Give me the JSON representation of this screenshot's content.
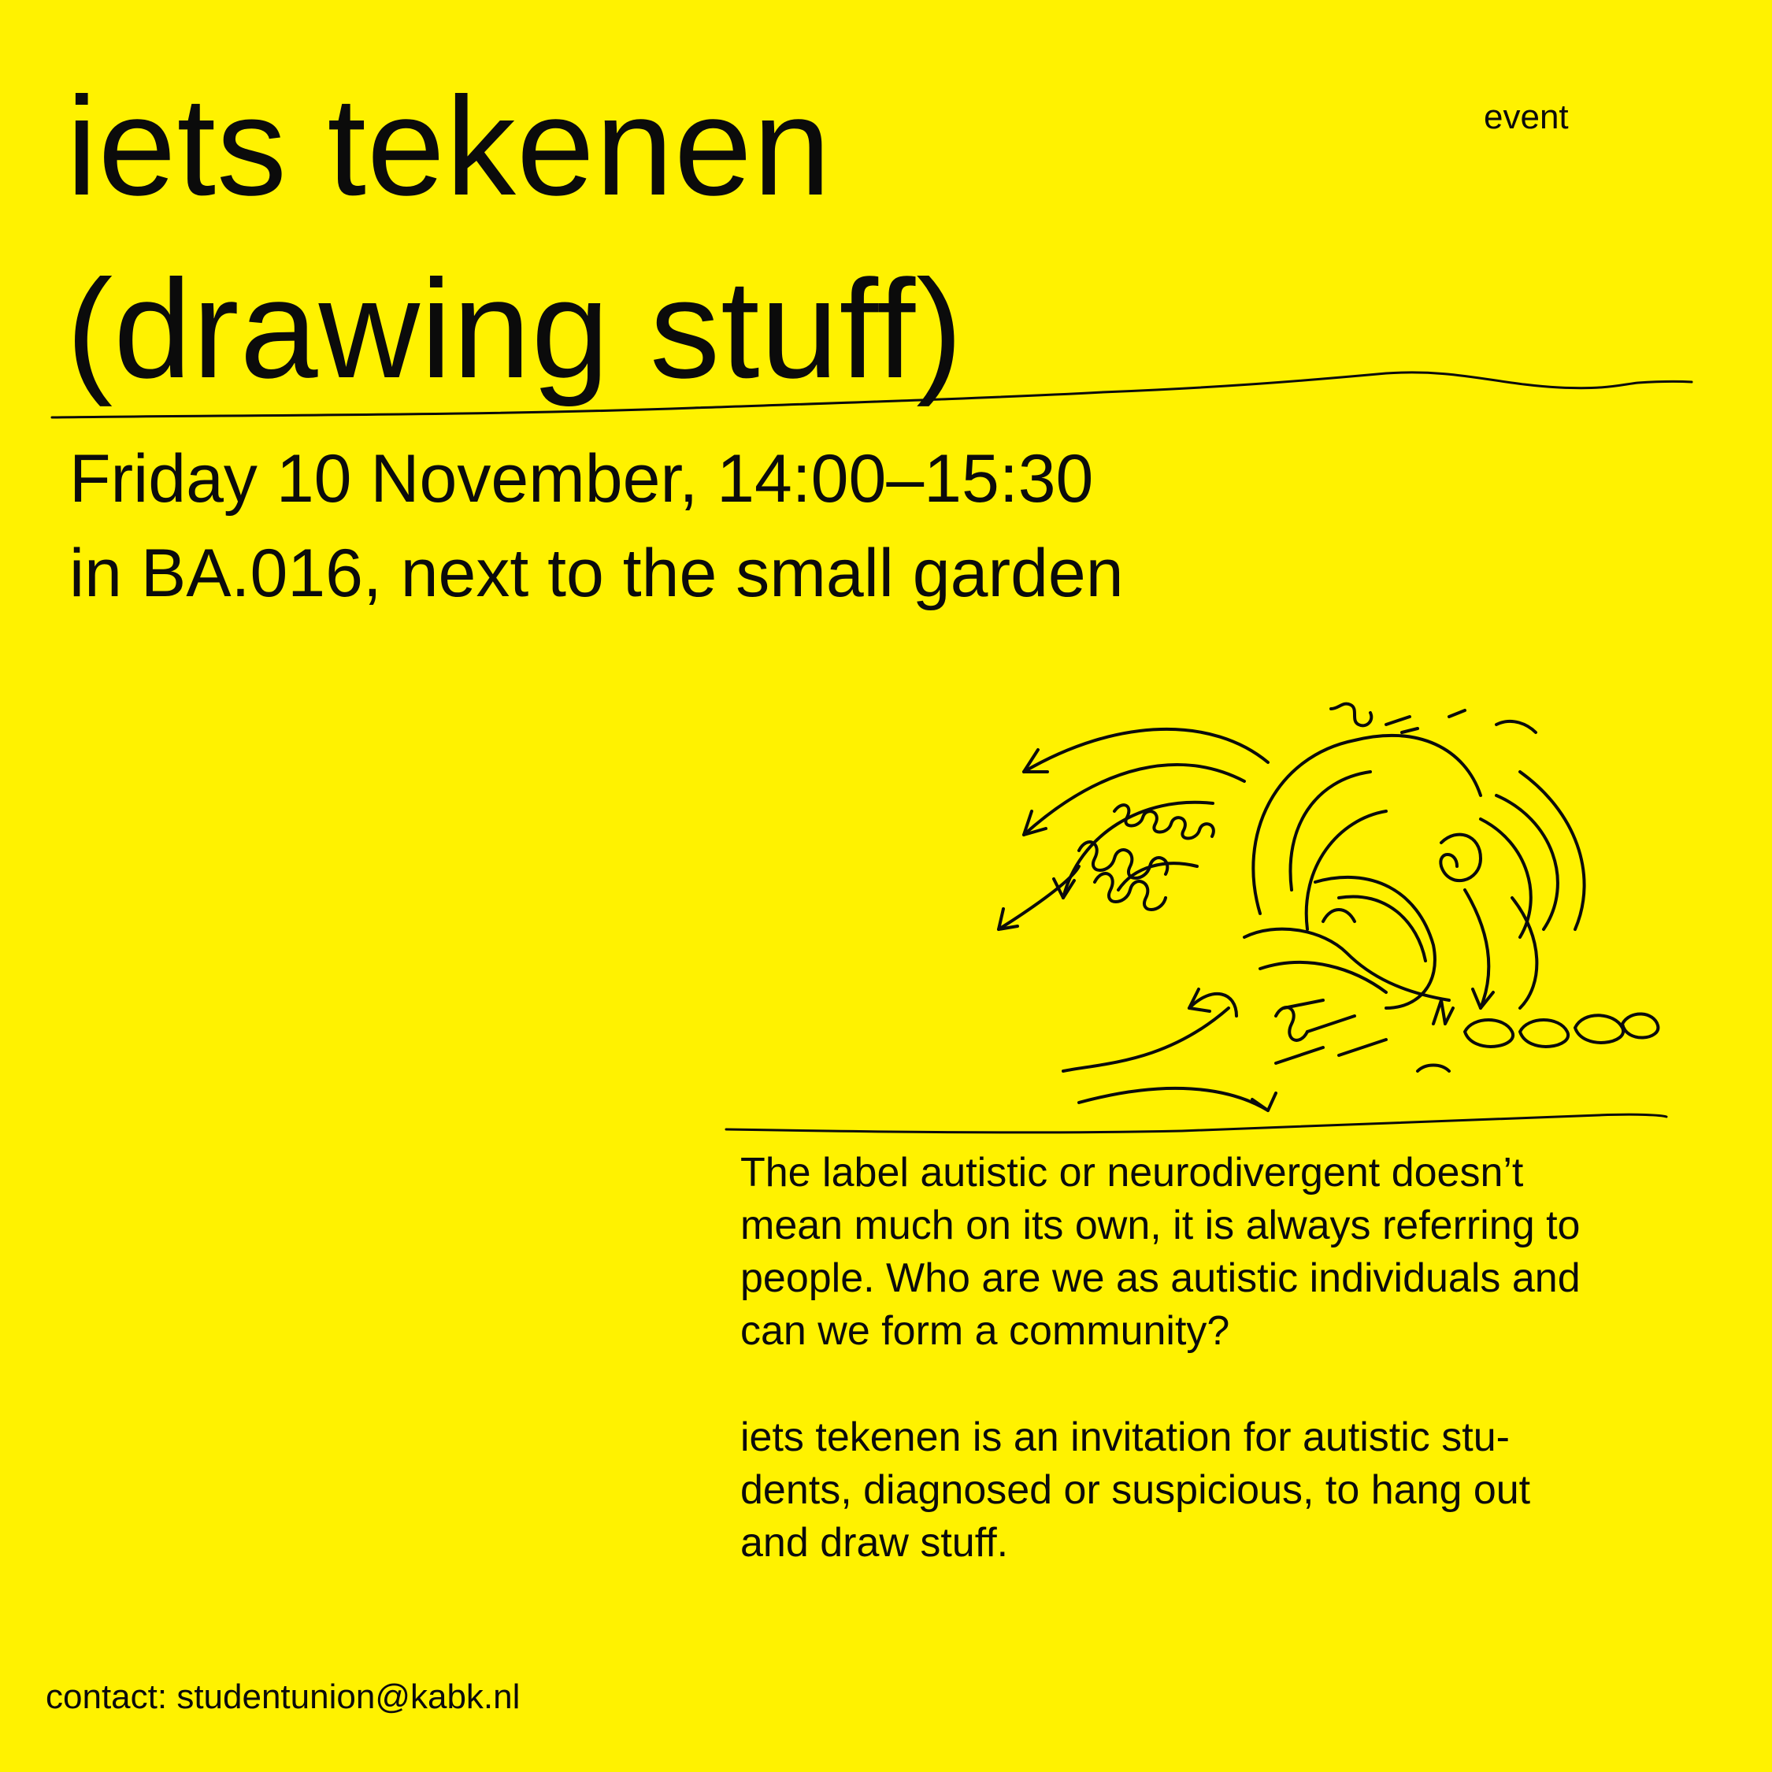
{
  "poster": {
    "title_line1": "iets tekenen",
    "title_line2": "(drawing stuff)",
    "tag": "event",
    "date_line": "Friday 10 November, 14:00–15:30",
    "location_line": "in BA.016, next to the small garden",
    "paragraph1": "The label autistic or neurodivergent doesn’t\nmean much on its own, it is always referring to\npeople. Who are we as autistic individuals and\ncan we form a community?",
    "paragraph2": "iets tekenen is an invitation for autistic stu-\ndents, diagnosed or suspicious, to hang out\nand draw stuff.",
    "contact_label": "contact:",
    "contact_email": "studentunion@kabk.nl"
  },
  "colors": {
    "background": "#fff200",
    "ink": "#0b0b0b"
  },
  "icons": {
    "illustration": "hand-drawn-wave-doodle-icon",
    "divider_top": "hand-drawn-wavy-line",
    "divider_bottom": "hand-drawn-line"
  }
}
